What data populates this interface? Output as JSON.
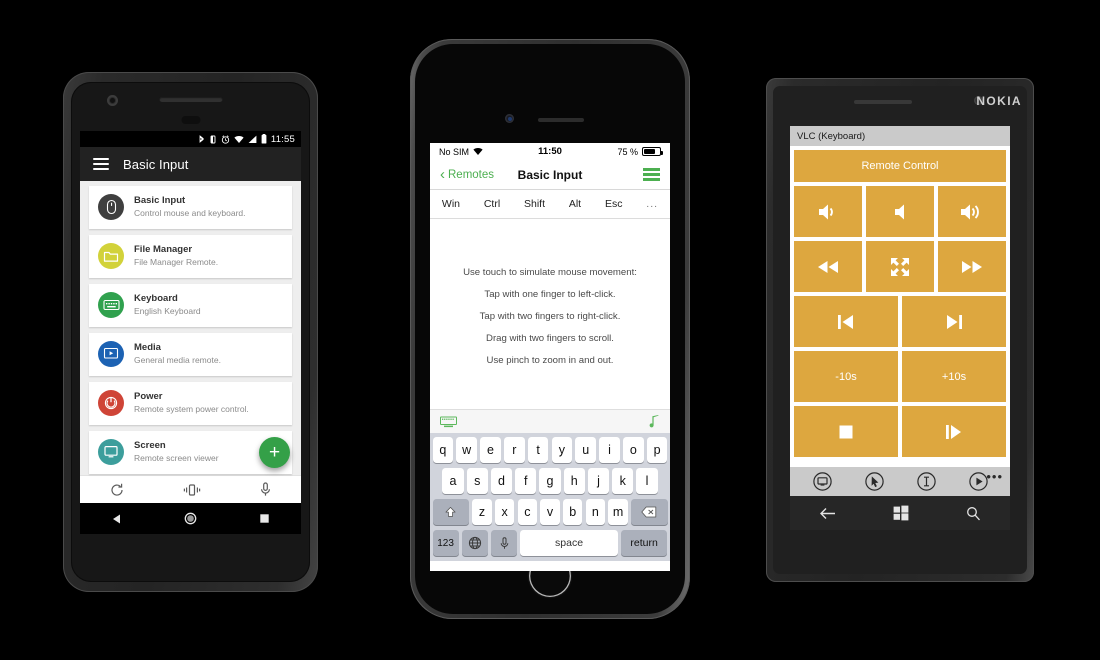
{
  "android": {
    "status_bar": {
      "time": "11:55",
      "icons": [
        "bluetooth-icon",
        "vibrate-icon",
        "alarm-icon",
        "wifi-icon",
        "signal-icon",
        "battery-icon"
      ]
    },
    "app_bar": {
      "title": "Basic Input",
      "menu_icon": "hamburger-menu-icon"
    },
    "list": [
      {
        "title": "Basic Input",
        "subtitle": "Control mouse and keyboard.",
        "icon": "mouse-icon",
        "color": "#3f3f3f"
      },
      {
        "title": "File Manager",
        "subtitle": "File Manager Remote.",
        "icon": "folder-icon",
        "color": "#d2d23a"
      },
      {
        "title": "Keyboard",
        "subtitle": "English Keyboard",
        "icon": "keyboard-icon",
        "color": "#30a14e"
      },
      {
        "title": "Media",
        "subtitle": "General media remote.",
        "icon": "media-icon",
        "color": "#1c62b3"
      },
      {
        "title": "Power",
        "subtitle": "Remote system power control.",
        "icon": "power-icon",
        "color": "#cf4437"
      },
      {
        "title": "Screen",
        "subtitle": "Remote screen viewer",
        "icon": "monitor-icon",
        "color": "#3c9e9c"
      }
    ],
    "fab": {
      "label": "+",
      "color": "#34a048",
      "name": "add-remote-fab"
    },
    "bottom_bar": [
      "refresh-icon",
      "vibrate-phone-icon",
      "microphone-icon"
    ],
    "nav_bar": [
      "back-triangle-icon",
      "home-circle-icon",
      "recents-square-icon"
    ]
  },
  "iphone": {
    "status_bar": {
      "carrier": "No SIM",
      "wifi": "wifi-icon",
      "time": "11:50",
      "battery_percent": "75 %"
    },
    "nav_bar": {
      "back_label": "Remotes",
      "title": "Basic Input",
      "menu_icon": "hamburger-menu-icon",
      "accent": "#4caf50"
    },
    "modifier_keys": [
      "Win",
      "Ctrl",
      "Shift",
      "Alt",
      "Esc",
      "..."
    ],
    "touchpad_instructions": [
      "Use touch to simulate mouse movement:",
      "Tap with one finger to left-click.",
      "Tap with two fingers to right-click.",
      "Drag with two fingers to scroll.",
      "Use pinch to zoom in and out."
    ],
    "accessory_bar": {
      "left_icon": "keyboard-icon",
      "right_icon": "music-note-icon",
      "accent": "#5cb85c"
    },
    "keyboard": {
      "row1": [
        "q",
        "w",
        "e",
        "r",
        "t",
        "y",
        "u",
        "i",
        "o",
        "p"
      ],
      "row2": [
        "a",
        "s",
        "d",
        "f",
        "g",
        "h",
        "j",
        "k",
        "l"
      ],
      "row3_shift": "shift-icon",
      "row3": [
        "z",
        "x",
        "c",
        "v",
        "b",
        "n",
        "m"
      ],
      "row3_backspace": "backspace-icon",
      "row4_numbers": "123",
      "row4_globe": "globe-icon",
      "row4_mic": "microphone-icon",
      "row4_space": "space",
      "row4_return": "return"
    }
  },
  "nokia": {
    "brand": "NOKIA",
    "title_bar": "VLC (Keyboard)",
    "header_button": "Remote Control",
    "accent": "#dda73f",
    "grid": [
      [
        {
          "icon": "volume-mute-icon",
          "label": ""
        },
        {
          "icon": "volume-down-icon",
          "label": ""
        },
        {
          "icon": "volume-up-icon",
          "label": ""
        }
      ],
      [
        {
          "icon": "rewind-icon",
          "label": ""
        },
        {
          "icon": "fullscreen-icon",
          "label": ""
        },
        {
          "icon": "fast-forward-icon",
          "label": ""
        }
      ],
      [
        {
          "icon": "previous-track-icon",
          "label": ""
        },
        {
          "icon": "next-track-icon",
          "label": ""
        }
      ],
      [
        {
          "icon": "",
          "label": "-10s"
        },
        {
          "icon": "",
          "label": "+10s"
        }
      ],
      [
        {
          "icon": "stop-icon",
          "label": ""
        },
        {
          "icon": "frame-step-icon",
          "label": ""
        }
      ]
    ],
    "app_bar": [
      "screen-icon",
      "cursor-icon",
      "text-cursor-icon",
      "play-icon"
    ],
    "app_bar_more": "•••",
    "nav_bar": [
      "back-arrow-icon",
      "windows-start-icon",
      "search-icon"
    ]
  }
}
